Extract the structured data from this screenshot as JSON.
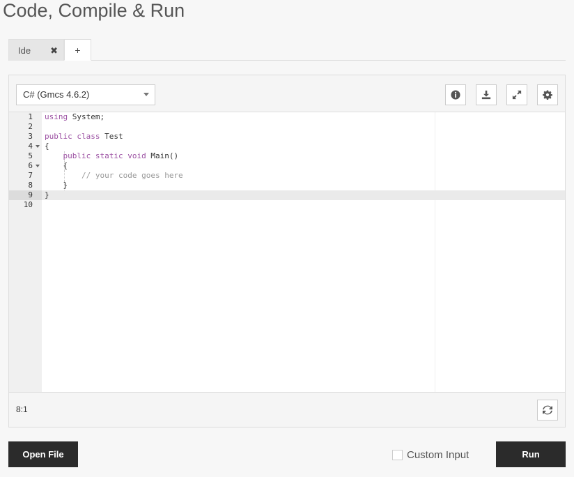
{
  "page": {
    "title": "Code, Compile & Run"
  },
  "tabs": [
    {
      "label": "Ide",
      "close_symbol": "✖"
    },
    {
      "label": "+"
    }
  ],
  "toolbar": {
    "language": "C# (Gmcs 4.6.2)",
    "buttons": [
      "info-icon",
      "download-icon",
      "fullscreen-icon",
      "settings-icon"
    ]
  },
  "editor": {
    "lines": [
      {
        "num": "1",
        "fold": false,
        "parts": [
          {
            "t": "using",
            "c": "kw"
          },
          {
            "t": " System;",
            "c": ""
          }
        ]
      },
      {
        "num": "2",
        "fold": false,
        "parts": []
      },
      {
        "num": "3",
        "fold": false,
        "parts": [
          {
            "t": "public",
            "c": "kw"
          },
          {
            "t": " ",
            "c": ""
          },
          {
            "t": "class",
            "c": "kw"
          },
          {
            "t": " Test",
            "c": ""
          }
        ]
      },
      {
        "num": "4",
        "fold": true,
        "parts": [
          {
            "t": "{",
            "c": ""
          }
        ]
      },
      {
        "num": "5",
        "fold": false,
        "parts": [
          {
            "t": "    ",
            "c": ""
          },
          {
            "t": "public",
            "c": "kw"
          },
          {
            "t": " ",
            "c": ""
          },
          {
            "t": "static",
            "c": "kw"
          },
          {
            "t": " ",
            "c": ""
          },
          {
            "t": "void",
            "c": "kw"
          },
          {
            "t": " Main()",
            "c": ""
          }
        ]
      },
      {
        "num": "6",
        "fold": true,
        "parts": [
          {
            "t": "    {",
            "c": ""
          }
        ]
      },
      {
        "num": "7",
        "fold": false,
        "parts": [
          {
            "t": "        ",
            "c": ""
          },
          {
            "t": "// your code goes here",
            "c": "cm"
          }
        ]
      },
      {
        "num": "8",
        "fold": false,
        "parts": [
          {
            "t": "    }",
            "c": ""
          }
        ]
      },
      {
        "num": "9",
        "fold": false,
        "parts": [
          {
            "t": "}",
            "c": ""
          }
        ]
      },
      {
        "num": "10",
        "fold": false,
        "parts": []
      }
    ],
    "active_line": 9
  },
  "status": {
    "cursor": "8:1"
  },
  "footer": {
    "open_file_label": "Open File",
    "custom_input_label": "Custom Input",
    "run_label": "Run"
  }
}
